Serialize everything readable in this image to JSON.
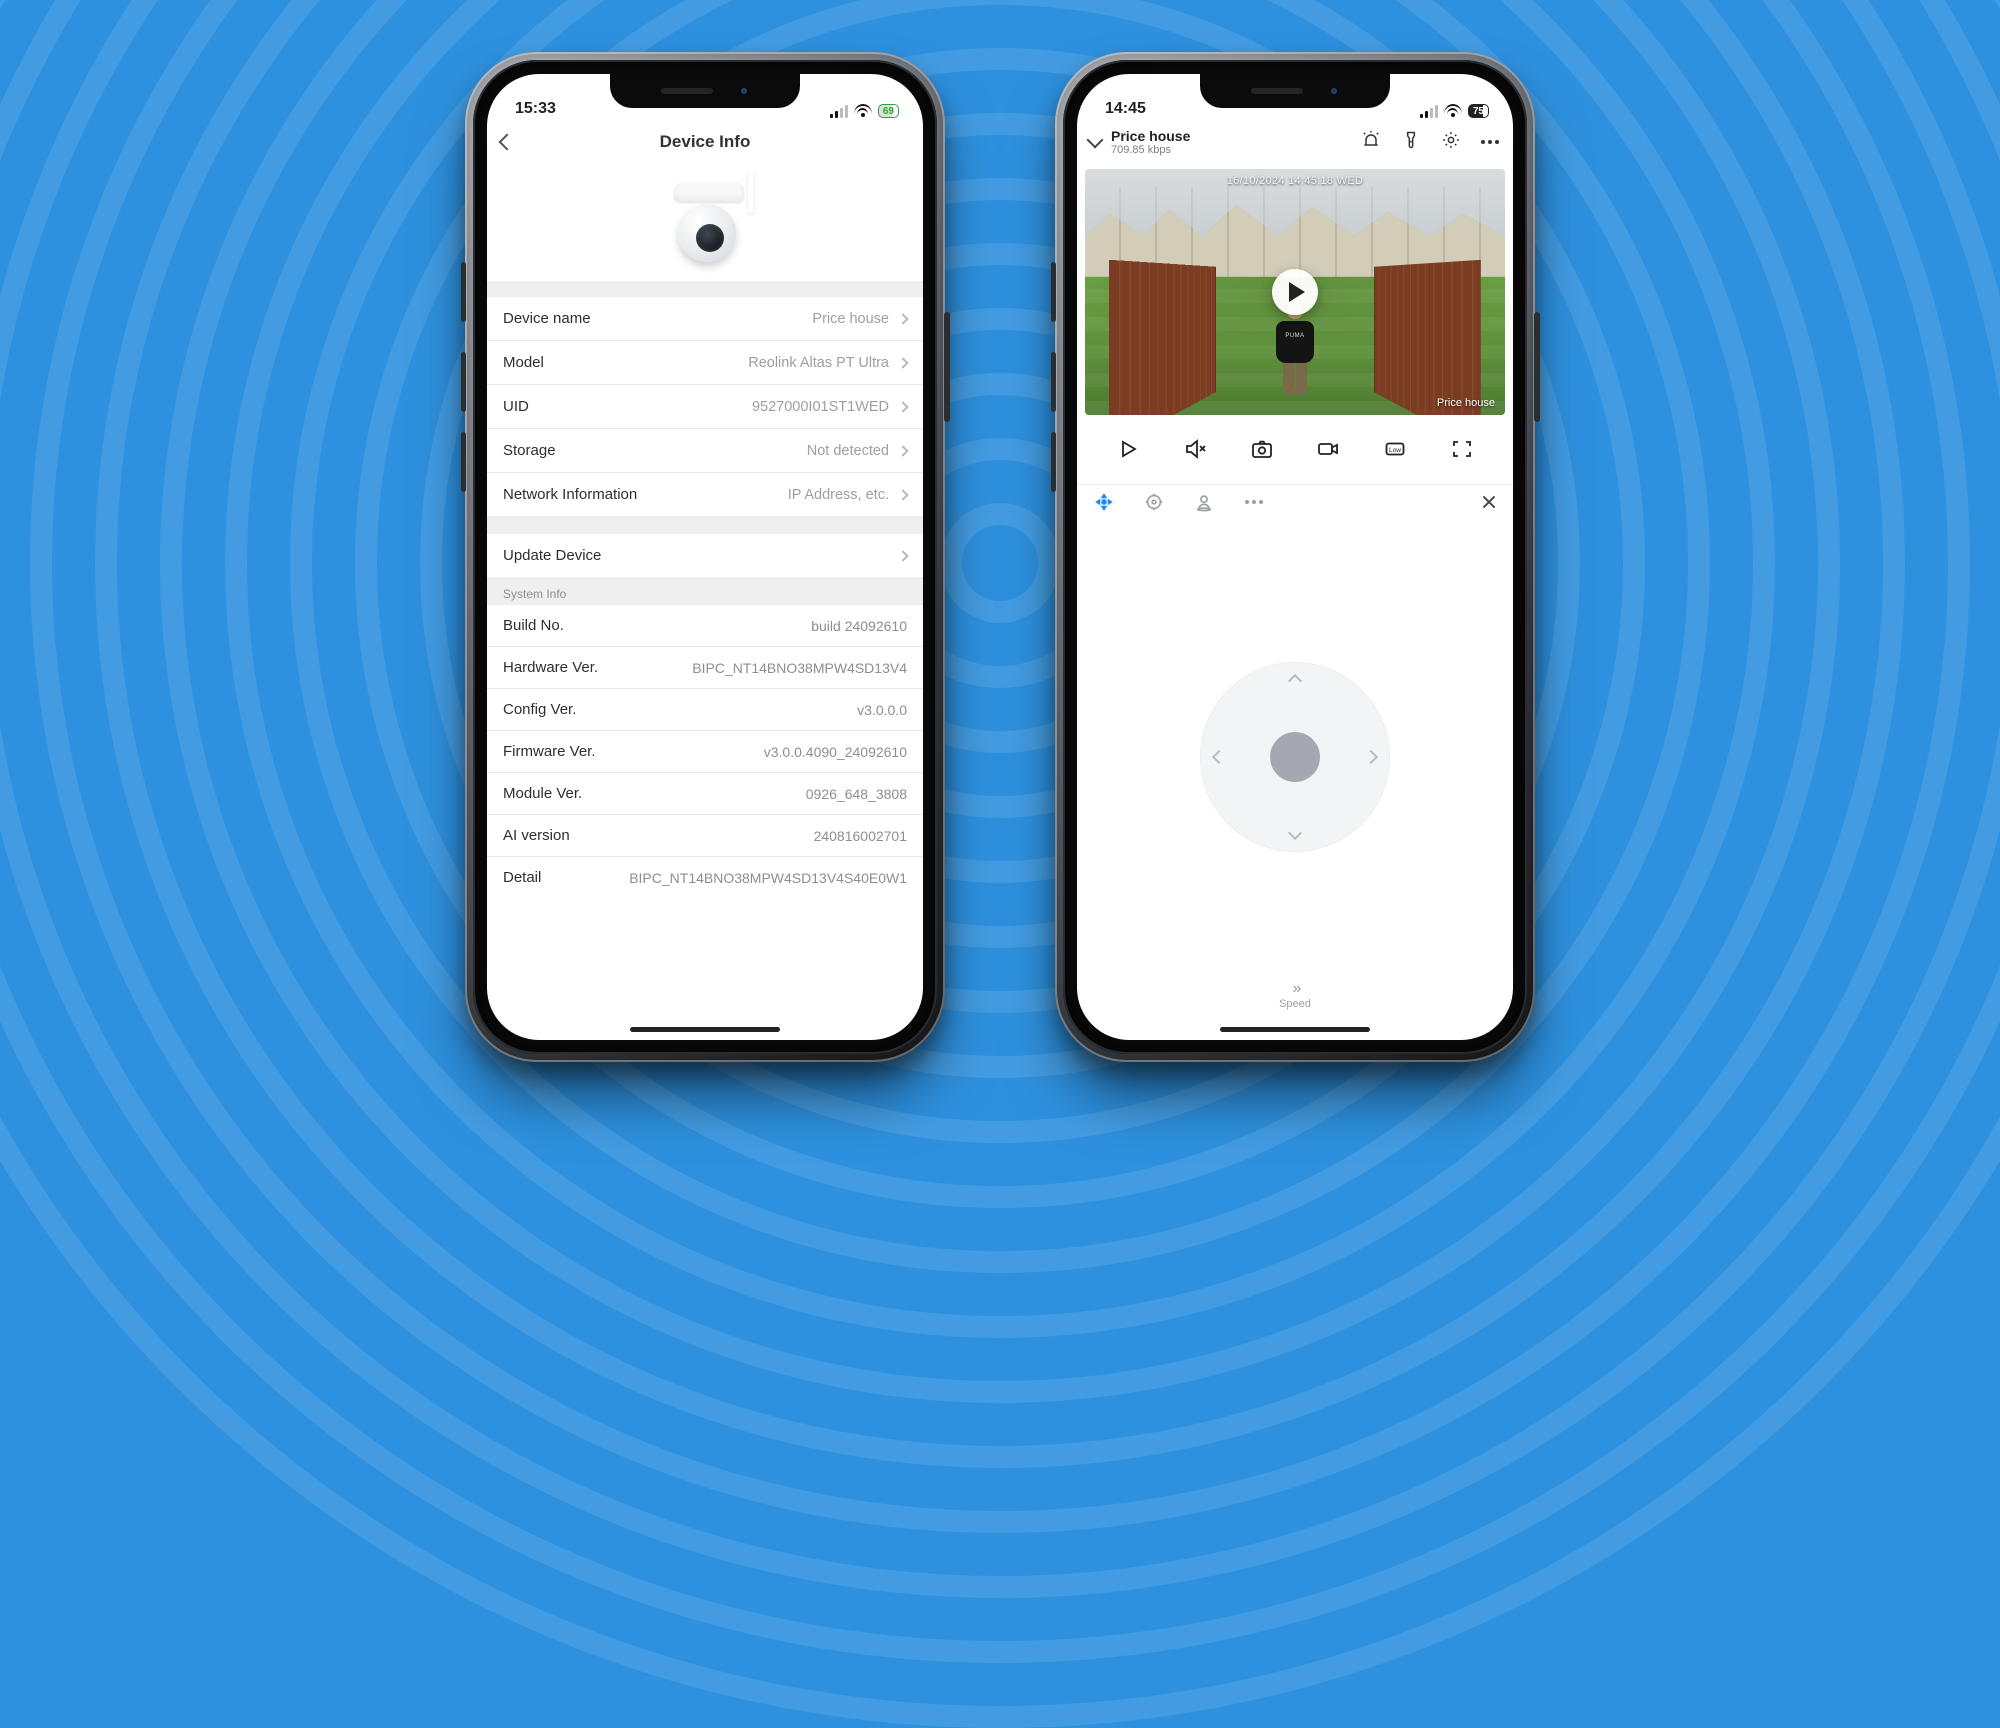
{
  "left": {
    "status": {
      "time": "15:33",
      "battery": "69"
    },
    "nav_title": "Device Info",
    "rows": [
      {
        "label": "Device name",
        "value": "Price house"
      },
      {
        "label": "Model",
        "value": "Reolink Altas PT Ultra"
      },
      {
        "label": "UID",
        "value": "9527000I01ST1WED"
      },
      {
        "label": "Storage",
        "value": "Not detected"
      },
      {
        "label": "Network Information",
        "value": "IP Address, etc."
      }
    ],
    "update_label": "Update Device",
    "system_header": "System Info",
    "system": [
      {
        "label": "Build No.",
        "value": "build 24092610"
      },
      {
        "label": "Hardware Ver.",
        "value": "BIPC_NT14BNO38MPW4SD13V4"
      },
      {
        "label": "Config Ver.",
        "value": "v3.0.0.0"
      },
      {
        "label": "Firmware Ver.",
        "value": "v3.0.0.4090_24092610"
      },
      {
        "label": "Module Ver.",
        "value": "0926_648_3808"
      },
      {
        "label": "AI version",
        "value": "240816002701"
      },
      {
        "label": "Detail",
        "value": "BIPC_NT14BNO38MPW4SD13V4S40E0W1"
      }
    ]
  },
  "right": {
    "status": {
      "time": "14:45",
      "battery": "75"
    },
    "header": {
      "name": "Price house",
      "bitrate": "709.85 kbps"
    },
    "overlay": {
      "timestamp": "16/10/2024 14:45:18 WED",
      "corner": "Price house"
    },
    "controls": {
      "play": "play-icon",
      "mute": "mute-icon",
      "snapshot": "snapshot-icon",
      "record": "record-icon",
      "quality": "quality-low-icon",
      "fullscreen": "fullscreen-icon"
    },
    "tools": {
      "ptz": "ptz-icon",
      "focus": "focus-icon",
      "patrol": "patrol-icon",
      "more": "more-icon",
      "close": "close-icon"
    },
    "speed_label": "Speed"
  }
}
